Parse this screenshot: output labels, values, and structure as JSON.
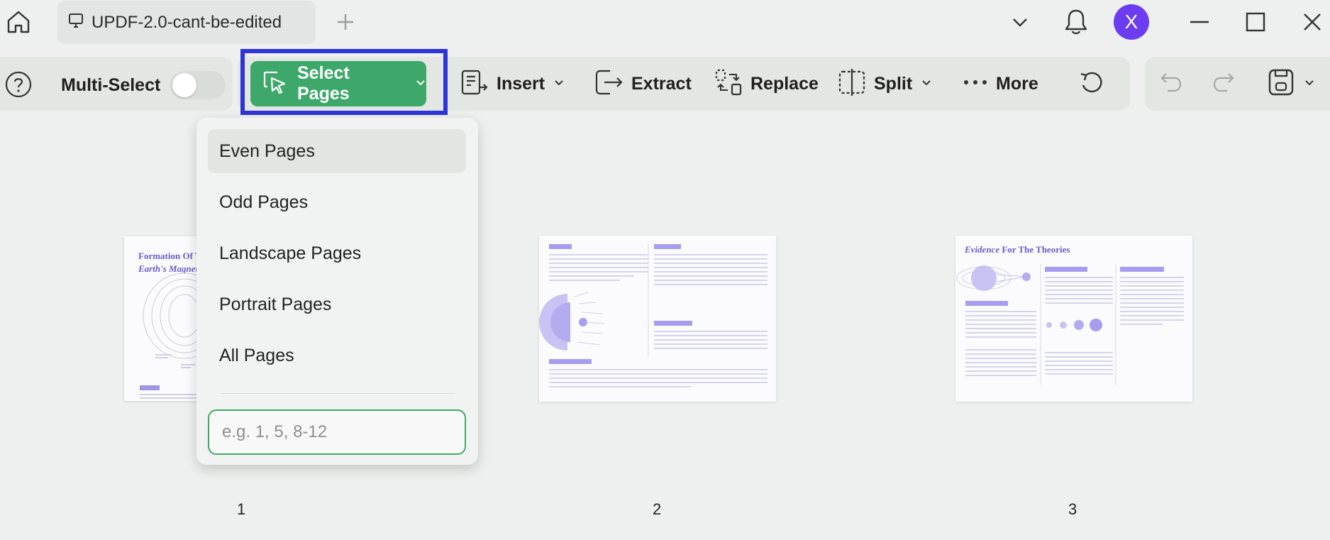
{
  "tab": {
    "title": "UPDF-2.0-cant-be-edited"
  },
  "user": {
    "avatar_letter": "X"
  },
  "toolbar": {
    "multi_select_label": "Multi-Select",
    "select_pages_label": "Select Pages",
    "insert_label": "Insert",
    "extract_label": "Extract",
    "replace_label": "Replace",
    "split_label": "Split",
    "more_label": "More"
  },
  "dropdown": {
    "items": [
      {
        "label": "Even Pages"
      },
      {
        "label": "Odd Pages"
      },
      {
        "label": "Landscape Pages"
      },
      {
        "label": "Portrait Pages"
      },
      {
        "label": "All Pages"
      }
    ],
    "range_placeholder": "e.g. 1, 5, 8-12"
  },
  "pages": [
    {
      "number": "1",
      "title_line1": "Formation Of T",
      "title_line2": "Earth's Magnet"
    },
    {
      "number": "2"
    },
    {
      "number": "3",
      "title_accent": "Evidence",
      "title_rest": " For The Theories"
    }
  ],
  "colors": {
    "accent_green": "#3ea86b",
    "highlight_frame": "#2e35d8",
    "avatar": "#6b3cf0",
    "doc_purple": "#6a5cc9"
  }
}
